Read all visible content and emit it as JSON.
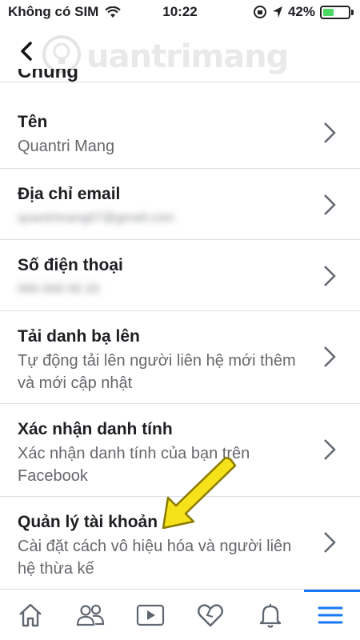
{
  "status_bar": {
    "carrier": "Không có SIM",
    "time": "10:22",
    "battery_percent": "42%",
    "battery_level": 0.42,
    "battery_color": "#4cd964"
  },
  "nav": {
    "back_icon": "chevron-left-icon",
    "watermark": "uantrimang"
  },
  "section": {
    "header_partial": "Chung"
  },
  "rows": [
    {
      "title": "Tên",
      "subtitle": "Quantri Mang",
      "blurred": false
    },
    {
      "title": "Địa chỉ email",
      "subtitle": "quantrimang07@gmail.com",
      "blurred": true
    },
    {
      "title": "Số điện thoại",
      "subtitle": "090 000 00 20",
      "blurred": true
    },
    {
      "title": "Tải danh bạ lên",
      "subtitle": "Tự động tải lên người liên hệ mới thêm và mới cập nhật",
      "blurred": false
    },
    {
      "title": "Xác nhận danh tính",
      "subtitle": "Xác nhận danh tính của bạn trên Facebook",
      "blurred": false
    },
    {
      "title": "Quản lý tài khoản",
      "subtitle": "Cài đặt cách vô hiệu hóa và người liên hệ thừa kế",
      "blurred": false
    }
  ],
  "tab_bar": {
    "tabs": [
      "home-icon",
      "friends-icon",
      "watch-icon",
      "dating-heart-icon",
      "notifications-bell-icon",
      "menu-icon"
    ],
    "active": "menu-icon",
    "accent": "#1877f2"
  },
  "annotation": {
    "arrow_color": "#f5e21b"
  }
}
